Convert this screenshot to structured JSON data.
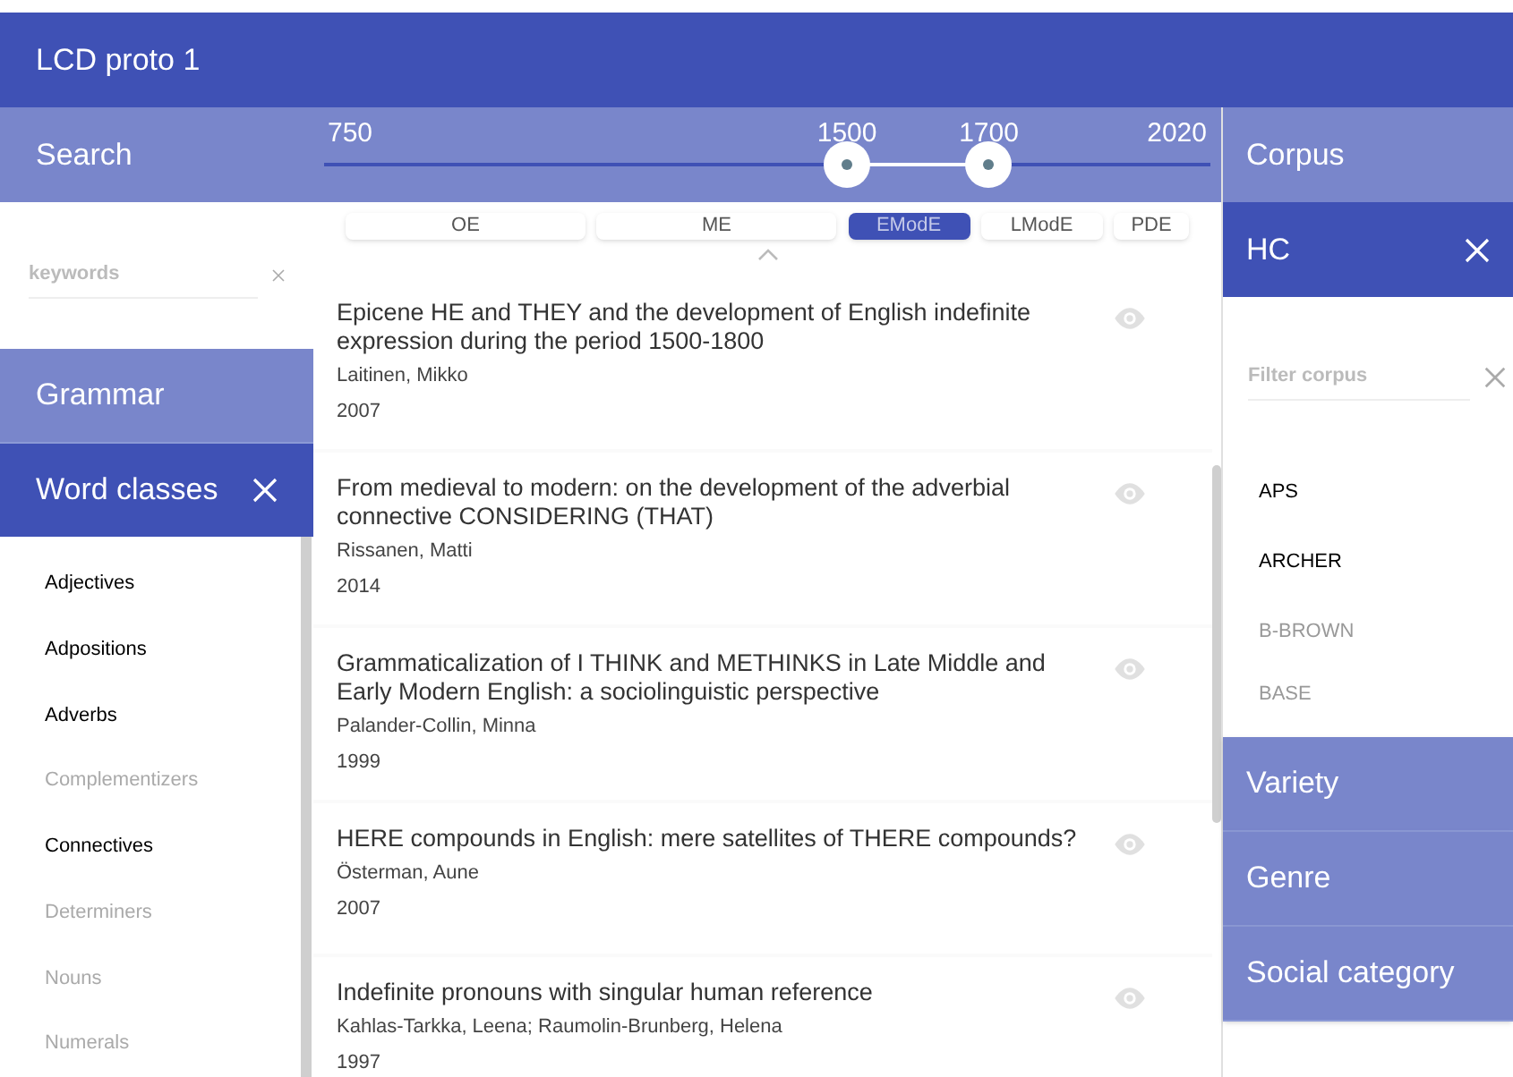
{
  "app_bar": {
    "title": "LCD proto 1"
  },
  "search": {
    "heading": "Search",
    "placeholder": "keywords"
  },
  "grammar": {
    "heading": "Grammar"
  },
  "word_classes": {
    "heading": "Word classes",
    "items": [
      {
        "label": "Adjectives",
        "disabled": false
      },
      {
        "label": "Adpositions",
        "disabled": false
      },
      {
        "label": "Adverbs",
        "disabled": false
      },
      {
        "label": "Complementizers",
        "disabled": true
      },
      {
        "label": "Connectives",
        "disabled": false
      },
      {
        "label": "Determiners",
        "disabled": true
      },
      {
        "label": "Nouns",
        "disabled": true
      },
      {
        "label": "Numerals",
        "disabled": true
      }
    ]
  },
  "timeline": {
    "min": "750",
    "max": "2020",
    "low": {
      "label": "1500",
      "level": 0.59
    },
    "high": {
      "label": "1700",
      "level": 0.75
    }
  },
  "periods": [
    {
      "label": "OE",
      "selected": false
    },
    {
      "label": "ME",
      "selected": false
    },
    {
      "label": "EModE",
      "selected": true
    },
    {
      "label": "LModE",
      "selected": false
    },
    {
      "label": "PDE",
      "selected": false
    }
  ],
  "results": [
    {
      "title": "Epicene HE and THEY and the development of English indefinite expression during the period 1500-1800",
      "author": "Laitinen, Mikko",
      "year": "2007"
    },
    {
      "title": "From medieval to modern: on the development of the adverbial connective CONSIDERING (THAT)",
      "author": "Rissanen, Matti",
      "year": "2014"
    },
    {
      "title": "Grammaticalization of I THINK and METHINKS in Late Middle and Early Modern English: a sociolinguistic perspective",
      "author": "Palander-Collin, Minna",
      "year": "1999"
    },
    {
      "title": "HERE compounds in English: mere satellites of THERE compounds?",
      "author": "Österman, Aune",
      "year": "2007"
    },
    {
      "title": "Indefinite pronouns with singular human reference",
      "author": "Kahlas-Tarkka, Leena; Raumolin-Brunberg, Helena",
      "year": "1997"
    }
  ],
  "corpus": {
    "heading": "Corpus",
    "selected": "HC",
    "placeholder": "Filter corpus",
    "items": [
      {
        "label": "APS",
        "disabled": false
      },
      {
        "label": "ARCHER",
        "disabled": false
      },
      {
        "label": "B-BROWN",
        "disabled": true
      },
      {
        "label": "BASE",
        "disabled": true
      }
    ]
  },
  "filters": [
    "Variety",
    "Genre",
    "Social category"
  ]
}
